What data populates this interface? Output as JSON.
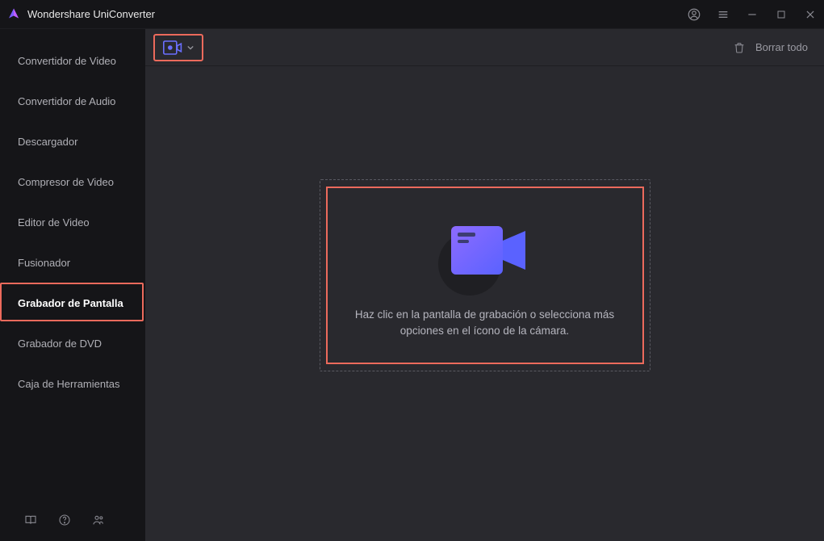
{
  "app": {
    "title": "Wondershare UniConverter"
  },
  "sidebar": {
    "items": [
      {
        "label": "Convertidor de Video"
      },
      {
        "label": "Convertidor de Audio"
      },
      {
        "label": "Descargador"
      },
      {
        "label": "Compresor de Video"
      },
      {
        "label": "Editor de Video"
      },
      {
        "label": "Fusionador"
      },
      {
        "label": "Grabador de Pantalla",
        "active": true
      },
      {
        "label": "Grabador de DVD"
      },
      {
        "label": "Caja de Herramientas"
      }
    ]
  },
  "toolbar": {
    "clear_all": "Borrar todo"
  },
  "dropzone": {
    "help": "Haz clic en la pantalla de grabación o selecciona más opciones en el ícono de la cámara."
  },
  "colors": {
    "accent": "#ec6a5c",
    "primary1": "#7a5cff",
    "primary2": "#5a6bff"
  }
}
